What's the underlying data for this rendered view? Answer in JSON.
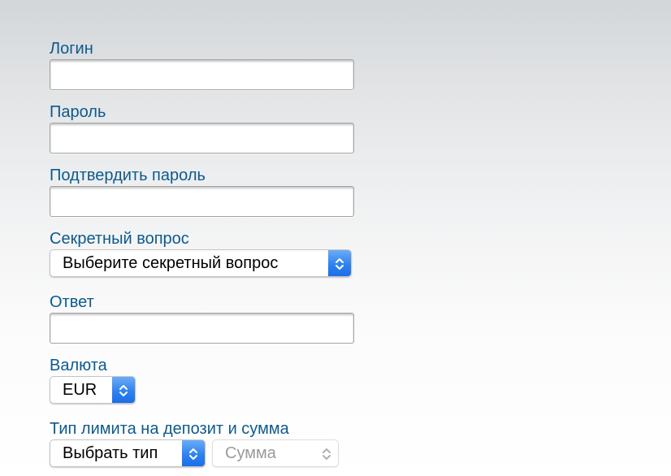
{
  "form": {
    "login": {
      "label": "Логин",
      "value": ""
    },
    "password": {
      "label": "Пароль",
      "value": ""
    },
    "confirm_password": {
      "label": "Подтвердить пароль",
      "value": ""
    },
    "secret_question": {
      "label": "Секретный вопрос",
      "selected": "Выберите секретный вопрос"
    },
    "answer": {
      "label": "Ответ",
      "value": ""
    },
    "currency": {
      "label": "Валюта",
      "selected": "EUR"
    },
    "deposit_limit": {
      "label": "Тип лимита на депозит и сумма",
      "type_selected": "Выбрать тип",
      "amount_placeholder": "Сумма"
    }
  },
  "colors": {
    "label": "#0d5a8c",
    "select_accent": "#2f82ef",
    "background_top": "#d3d6d9",
    "background_bottom": "#ffffff"
  },
  "icons": {
    "select_stepper": "chevron-up-down-icon"
  }
}
